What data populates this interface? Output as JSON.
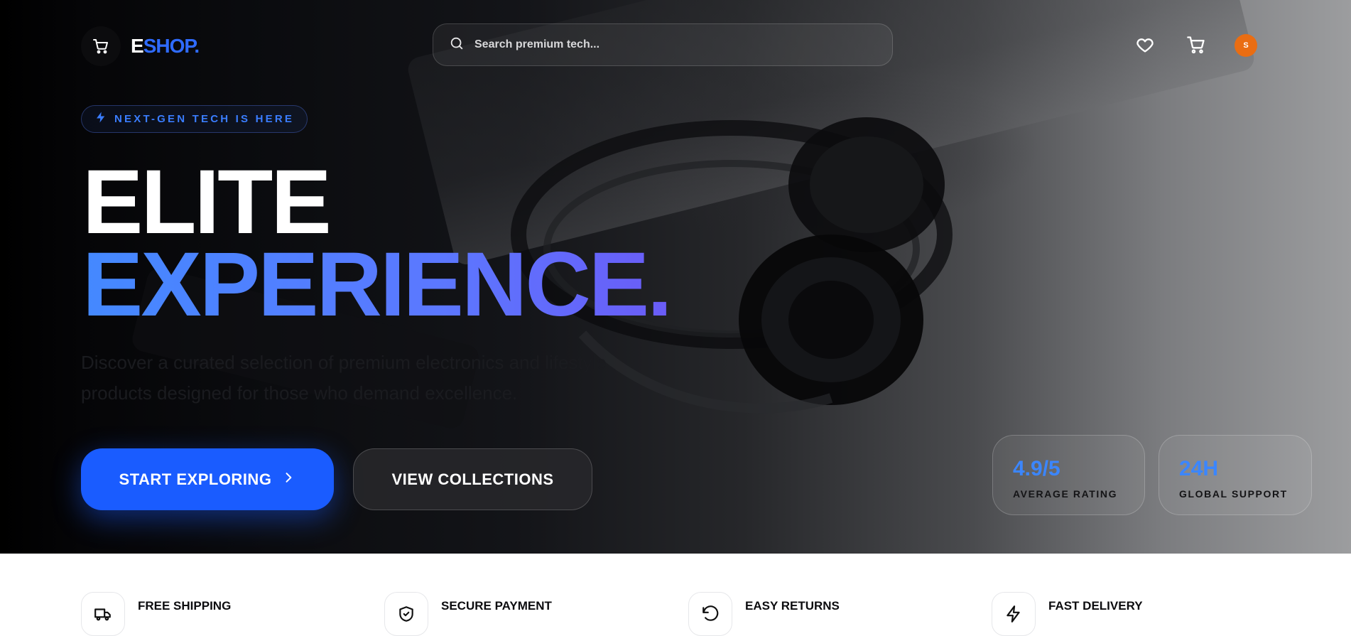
{
  "brand": {
    "logo_e": "E",
    "logo_rest": "SHOP."
  },
  "search": {
    "placeholder": "Search premium tech..."
  },
  "nav": {
    "avatar_initial": "S"
  },
  "hero": {
    "badge": "NEXT-GEN TECH IS HERE",
    "title_line1": "ELITE",
    "title_line2": "EXPERIENCE.",
    "description": "Discover a curated selection of premium electronics and lifestyle products designed for those who demand excellence.",
    "primary_cta": "START EXPLORING",
    "secondary_cta": "VIEW COLLECTIONS"
  },
  "stats": [
    {
      "value": "4.9/5",
      "label": "AVERAGE RATING"
    },
    {
      "value": "24H",
      "label": "GLOBAL SUPPORT"
    }
  ],
  "features": [
    {
      "title": "FREE SHIPPING",
      "icon": "truck-icon"
    },
    {
      "title": "SECURE PAYMENT",
      "icon": "shield-check-icon"
    },
    {
      "title": "EASY RETURNS",
      "icon": "rotate-ccw-icon"
    },
    {
      "title": "FAST DELIVERY",
      "icon": "zap-icon"
    }
  ],
  "colors": {
    "accent": "#1a5cff",
    "accent_light": "#3b86ff",
    "avatar": "#ea6d12",
    "hero_bg": "#000000"
  }
}
